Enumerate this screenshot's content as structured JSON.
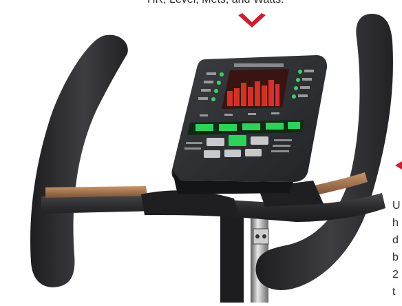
{
  "top_caption": "HR, Level, Mets, and Watts.",
  "right_caption_lines": [
    "U",
    "h",
    "d",
    "b",
    "2",
    "t"
  ],
  "colors": {
    "accent_arrow": "#cc1f2f",
    "handlebar": "#2a2a2c",
    "console": "#2c2d30",
    "led_red": "#d3322a",
    "led_green": "#2fd15a",
    "copper_grip": "#9a6b45"
  }
}
